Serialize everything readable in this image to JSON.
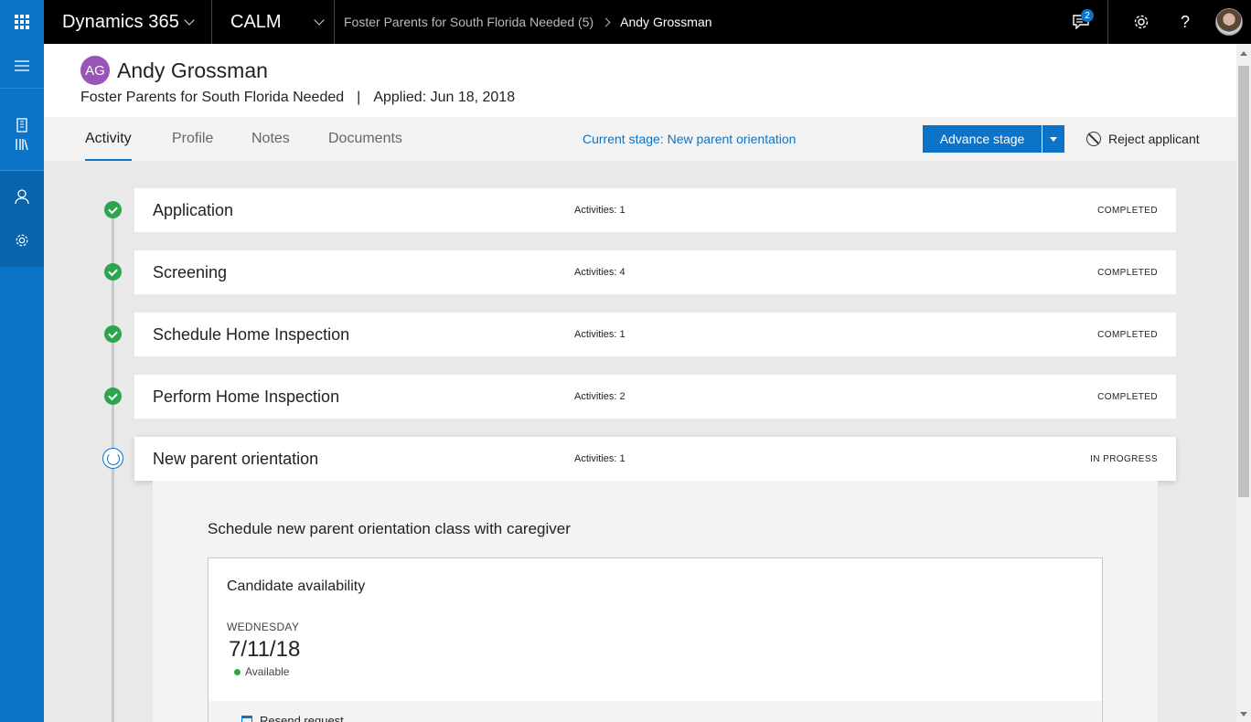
{
  "topbar": {
    "app_name": "Dynamics 365",
    "module": "CALM",
    "breadcrumb": [
      "Foster Parents for South Florida Needed (5)",
      "Andy Grossman"
    ],
    "notification_count": "2",
    "icons": [
      "waffle-icon",
      "chat-icon",
      "gear-icon",
      "help-icon",
      "user-avatar"
    ]
  },
  "leftnav": {
    "items": [
      "hamburger-icon",
      "building-icon",
      "library-icon",
      "person-icon",
      "settings-icon"
    ]
  },
  "header": {
    "initials": "AG",
    "name": "Andy Grossman",
    "job": "Foster Parents for South Florida Needed",
    "separator": "|",
    "applied": "Applied: Jun 18, 2018",
    "avatar_color": "#9855b5"
  },
  "tabs": [
    {
      "label": "Activity",
      "active": true
    },
    {
      "label": "Profile",
      "active": false
    },
    {
      "label": "Notes",
      "active": false
    },
    {
      "label": "Documents",
      "active": false
    }
  ],
  "current_stage": "Current stage: New parent orientation",
  "actions": {
    "advance_label": "Advance stage",
    "reject_label": "Reject applicant"
  },
  "stages": [
    {
      "title": "Application",
      "activities": "Activities: 1",
      "status": "COMPLETED"
    },
    {
      "title": "Screening",
      "activities": "Activities: 4",
      "status": "COMPLETED"
    },
    {
      "title": "Schedule Home Inspection",
      "activities": "Activities: 1",
      "status": "COMPLETED"
    },
    {
      "title": "Perform Home Inspection",
      "activities": "Activities: 2",
      "status": "COMPLETED"
    },
    {
      "title": "New parent orientation",
      "activities": "Activities: 1",
      "status": "IN PROGRESS"
    }
  ],
  "expanded": {
    "title": "Schedule new parent orientation class with caregiver",
    "card_title": "Candidate availability",
    "day": "WEDNESDAY",
    "date": "7/11/18",
    "availability": "Available",
    "resend_label": "Resend request"
  },
  "colors": {
    "accent": "#0b74c8",
    "completed": "#2da44e",
    "topbar": "#000000"
  }
}
